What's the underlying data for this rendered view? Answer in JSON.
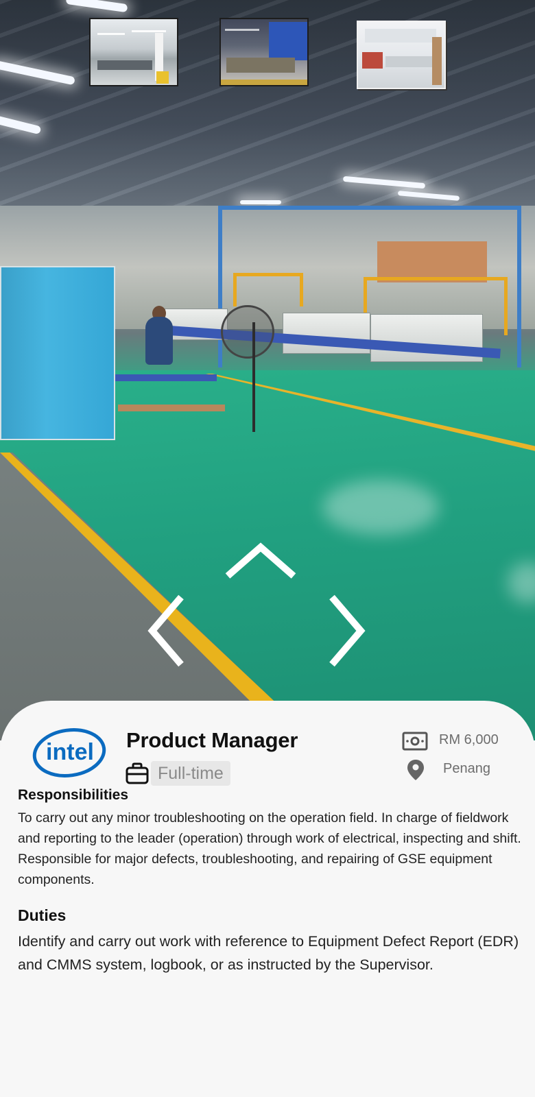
{
  "gallery": {
    "thumbnails": [
      {
        "name": "factory-floor-thumbnail"
      },
      {
        "name": "machinery-thumbnail"
      },
      {
        "name": "lab-room-thumbnail"
      }
    ],
    "icons": {
      "up": "chevron-up-icon",
      "left": "chevron-left-icon",
      "right": "chevron-right-icon"
    }
  },
  "job": {
    "company_logo": "intel",
    "title": "Product Manager",
    "type": "Full-time",
    "salary": "RM 6,000",
    "location": "Penang",
    "icons": {
      "type": "briefcase-icon",
      "salary": "money-icon",
      "location": "location-pin-icon"
    }
  },
  "responsibilities": {
    "heading": "Responsibilities",
    "text": "To carry out any minor troubleshooting on the operation field. In charge of fieldwork and reporting to the leader (operation) through work of electrical, inspecting and shift. Responsible for major defects, troubleshooting, and repairing of GSE equipment components."
  },
  "duties": {
    "heading": "Duties",
    "text": "Identify and carry out work with reference to Equipment Defect Report (EDR) and CMMS system, logbook, or as instructed by the Supervisor."
  },
  "colors": {
    "intel_blue": "#0b6bc0",
    "card_background": "#f7f7f7",
    "floor_green": "#22a383",
    "tag_background": "#e7e7e7"
  }
}
